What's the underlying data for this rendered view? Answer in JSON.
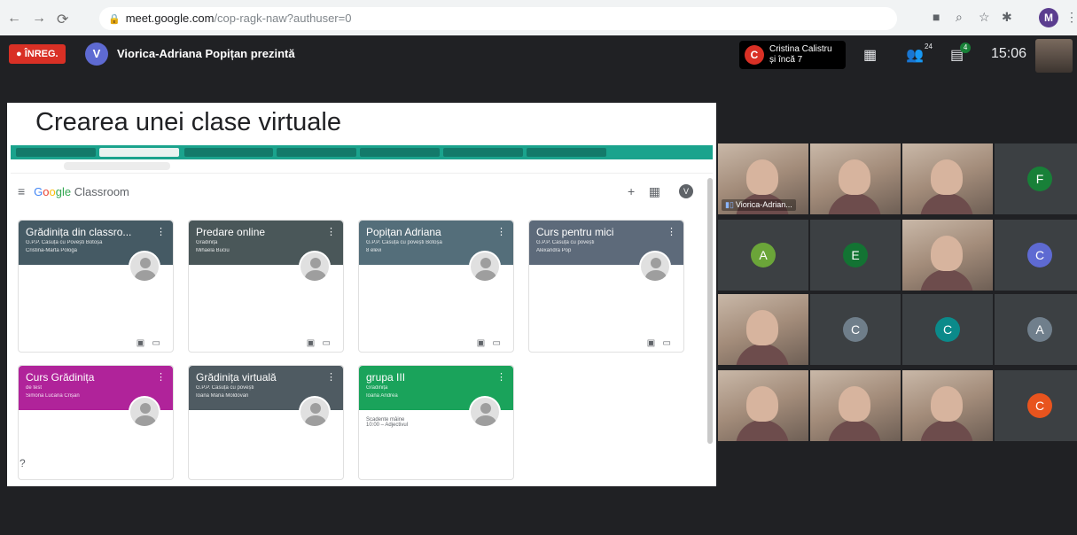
{
  "browser": {
    "url_domain": "meet.google.com",
    "url_path": "/cop-ragk-naw?authuser=0",
    "profile_initial": "M"
  },
  "meet": {
    "recording_label": "ÎNREG.",
    "presenter_initial": "V",
    "presenter_text": "Viorica-Adriana Popițan prezintă",
    "participant_initial": "C",
    "participant_line1": "Cristina Calistru",
    "participant_line2": "și încă 7",
    "participants_count": "24",
    "chat_badge": "4",
    "time": "15:06"
  },
  "slide": {
    "title": "Crearea unei clase virtuale",
    "classroom": {
      "logo_parts": [
        "G",
        "o",
        "o",
        "gle"
      ],
      "logo_suffix": "Classroom",
      "user_initial": "V",
      "cards": [
        {
          "title": "Grădinița din classro...",
          "subtitle": "G.P.P. Căsuța cu Povești Botoșa",
          "teacher": "Cristina-Marta Pologa",
          "color": "#455a64"
        },
        {
          "title": "Predare online",
          "subtitle": "Grădinița",
          "teacher": "Mihaela Buciu",
          "color": "#4a5759"
        },
        {
          "title": "Popițan Adriana",
          "subtitle": "G.P.P. Căsuța cu povești Botoșa",
          "teacher": "8 elevi",
          "color": "#546e7a"
        },
        {
          "title": "Curs pentru mici",
          "subtitle": "G.P.P. Căsuța cu povești",
          "teacher": "Alexandra Pop",
          "color": "#5d6a7a"
        },
        {
          "title": "Curs Grădinița",
          "subtitle": "de test",
          "teacher": "Simona Lucana Crișan",
          "color": "#b0239a"
        },
        {
          "title": "Grădinița virtuală",
          "subtitle": "G.P.P. Căsuța cu povești",
          "teacher": "Ioana Maria Moldovan",
          "color": "#4f5b62"
        },
        {
          "title": "grupa III",
          "subtitle": "Grădiniță",
          "teacher": "Ioana Andrea",
          "color": "#1aa35b",
          "due_title": "Scadente mâine",
          "due_item": "10:00 – Adjectivul"
        }
      ]
    }
  },
  "tiles": [
    {
      "kind": "photo",
      "label": "Viorica-Adrian..."
    },
    {
      "kind": "photo",
      "label": ""
    },
    {
      "kind": "photo",
      "label": ""
    },
    {
      "kind": "avatar",
      "initial": "F",
      "color": "#188038"
    },
    {
      "kind": "avatar",
      "initial": "A",
      "color": "#6ba539"
    },
    {
      "kind": "avatar",
      "initial": "E",
      "color": "#137333"
    },
    {
      "kind": "photo",
      "label": ""
    },
    {
      "kind": "avatar",
      "initial": "C",
      "color": "#5e6ad2"
    },
    {
      "kind": "photo",
      "label": ""
    },
    {
      "kind": "avatar",
      "initial": "C",
      "color": "#6f7e8a"
    },
    {
      "kind": "avatar",
      "initial": "C",
      "color": "#0b8a8a"
    },
    {
      "kind": "avatar",
      "initial": "A",
      "color": "#707f8c"
    },
    {
      "kind": "photo",
      "label": ""
    },
    {
      "kind": "photo",
      "label": ""
    },
    {
      "kind": "photo",
      "label": ""
    },
    {
      "kind": "avatar",
      "initial": "C",
      "color": "#e8541e"
    }
  ]
}
